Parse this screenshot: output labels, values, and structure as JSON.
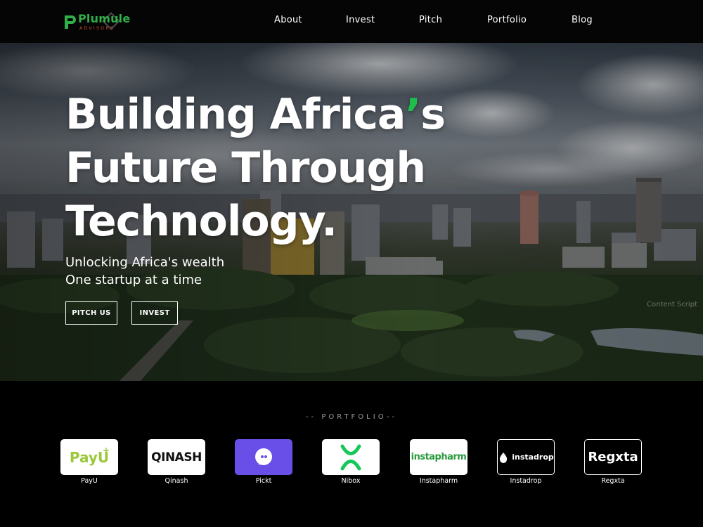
{
  "nav": {
    "logo_name": "Plumule",
    "logo_sub": "ADVISORS",
    "links": [
      "About",
      "Invest",
      "Pitch",
      "Portfolio",
      "Blog"
    ]
  },
  "hero": {
    "title_line1_a": "Building Africa",
    "title_line1_apos": "’",
    "title_line1_b": "s",
    "title_line2": "Future Through",
    "title_line3": "Technology.",
    "subtitle_line1": "Unlocking Africa's wealth",
    "subtitle_line2": "One startup at a time",
    "buttons": [
      "PITCH US",
      "INVEST"
    ],
    "watermark": "Content Script",
    "accent_color": "#1dbf4c"
  },
  "portfolio": {
    "heading": "-- PORTFOLIO--",
    "items": [
      {
        "name": "PayU",
        "logo_text": "PayU",
        "bg": "#ffffff",
        "color": "#9bc83a"
      },
      {
        "name": "Qinash",
        "logo_text": "QINASH",
        "bg": "#ffffff",
        "color": "#111111"
      },
      {
        "name": "Pickt",
        "logo_text": "",
        "bg": "#6a4ee8",
        "color": "#ffffff"
      },
      {
        "name": "Nibox",
        "logo_text": "",
        "bg": "#ffffff",
        "color": "#16c75a"
      },
      {
        "name": "Instapharm",
        "logo_text": "instapharm",
        "bg": "#ffffff",
        "color": "#2a9a3e"
      },
      {
        "name": "Instadrop",
        "logo_text": "instadrop",
        "bg": "#000000",
        "color": "#ffffff"
      },
      {
        "name": "Regxta",
        "logo_text": "Regxta",
        "bg": "#000000",
        "color": "#ffffff"
      }
    ]
  }
}
